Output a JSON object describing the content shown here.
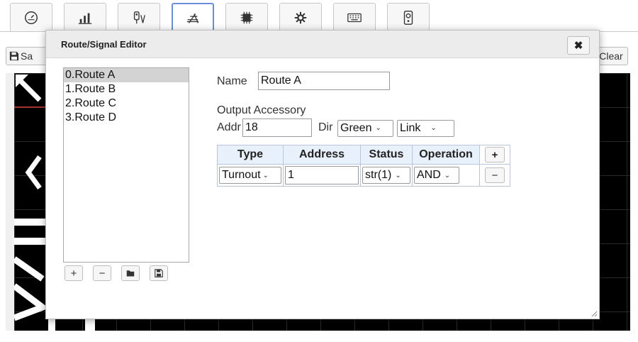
{
  "tabs": [
    {
      "icon": "gauge-icon"
    },
    {
      "icon": "bar-chart-icon"
    },
    {
      "icon": "signal-icon"
    },
    {
      "icon": "track-icon",
      "active": true
    },
    {
      "icon": "app-chip-icon"
    },
    {
      "icon": "gear-icon"
    },
    {
      "icon": "keyboard-icon"
    },
    {
      "icon": "speaker-icon"
    }
  ],
  "toolbar": {
    "save_label": "Sa",
    "clear_label": "Clear"
  },
  "dialog": {
    "title": "Route/Signal Editor",
    "close_icon": "close-icon",
    "routes": [
      "0.Route A",
      "1.Route B",
      "2.Route C",
      "3.Route D"
    ],
    "selected_route": "0.Route A",
    "list_buttons": [
      "add-icon",
      "remove-icon",
      "folder-icon",
      "save-icon"
    ],
    "name_label": "Name",
    "name_value": "Route A",
    "output_accessory_label": "Output Accessory",
    "addr_label": "Addr",
    "addr_value": "18",
    "dir_label": "Dir",
    "dir_value": "Green",
    "mode_value": "Link",
    "table": {
      "headers": [
        "Type",
        "Address",
        "Status",
        "Operation"
      ],
      "rows": [
        {
          "type": "Turnout",
          "address": "1",
          "status": "str(1)",
          "operation": "AND"
        }
      ]
    }
  },
  "colors": {
    "dialog_header": "#ececec",
    "table_header": "#e8f0fb",
    "active_tab_border": "#6a8fd8",
    "layout_background": "#000000",
    "track": "#ffffff",
    "track_highlight": "#d43b3b"
  }
}
